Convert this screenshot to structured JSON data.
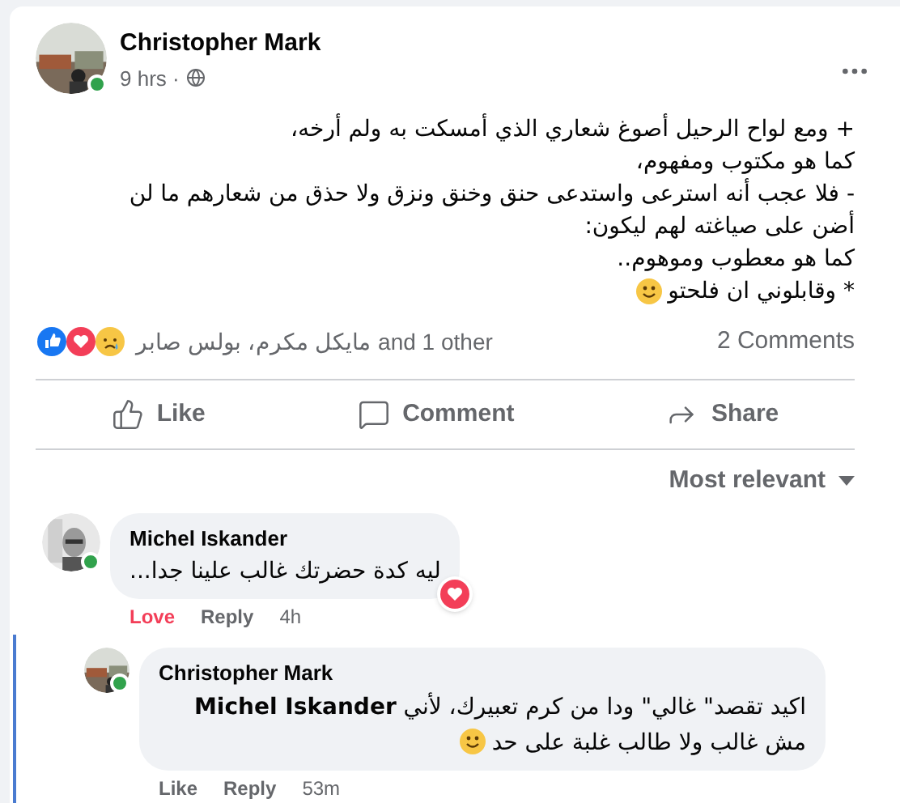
{
  "post": {
    "author": "Christopher Mark",
    "online": true,
    "time": "9 hrs ·",
    "text_lines": [
      "+ ومع لواح الرحيل أصوغ شعاري الذي أمسكت به ولم أرخه،",
      "كما هو مكتوب ومفهوم،",
      "- فلا عجب أنه استرعى واستدعى حنق وخنق ونزق ولا حذق من شعارهم ما لن أضن على صياغته لهم ليكون:",
      "كما هو معطوب وموهوم..",
      "* وقابلوني ان فلحتو"
    ]
  },
  "reactions": {
    "summary": "مايكل مكرم، بولس صابر and 1 other",
    "comments_count": "2 Comments"
  },
  "actions": {
    "like": "Like",
    "comment": "Comment",
    "share": "Share"
  },
  "sort": "Most relevant",
  "comments": [
    {
      "author": "Michel Iskander",
      "online": true,
      "text": "ليه كدة حضرتك غالب علينا جدا...",
      "reaction_label": "Love",
      "reacted": true,
      "love_badge": true,
      "reply_label": "Reply",
      "time": "4h",
      "smiley": false,
      "children": [
        {
          "author": "Christopher Mark",
          "online": true,
          "text": "اكيد تقصد\" غالي\" ودا من كرم تعبيرك، لأني **Michel Iskander** مش غالب ولا طالب غلبة على حد",
          "reaction_label": "Like",
          "reacted": false,
          "love_badge": false,
          "reply_label": "Reply",
          "time": "53m",
          "smiley": true
        }
      ]
    }
  ]
}
